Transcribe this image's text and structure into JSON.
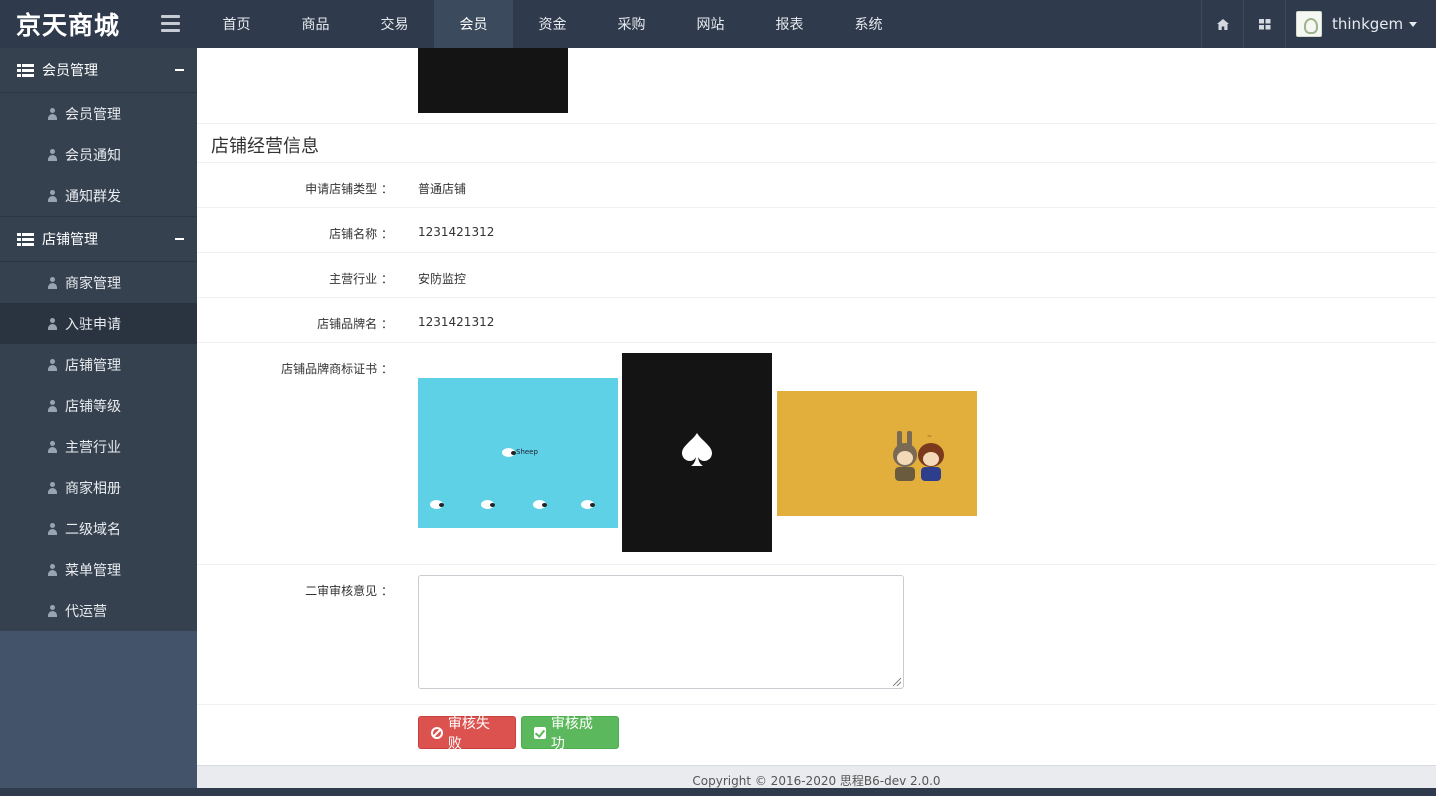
{
  "brand": {
    "title": "京天商城"
  },
  "nav": {
    "items": [
      {
        "label": "首页"
      },
      {
        "label": "商品"
      },
      {
        "label": "交易"
      },
      {
        "label": "会员"
      },
      {
        "label": "资金"
      },
      {
        "label": "采购"
      },
      {
        "label": "网站"
      },
      {
        "label": "报表"
      },
      {
        "label": "系统"
      }
    ],
    "active_index": 3
  },
  "user": {
    "name": "thinkgem"
  },
  "sidebar": {
    "groups": [
      {
        "label": "会员管理",
        "items": [
          {
            "label": "会员管理"
          },
          {
            "label": "会员通知"
          },
          {
            "label": "通知群发"
          }
        ]
      },
      {
        "label": "店铺管理",
        "items": [
          {
            "label": "商家管理"
          },
          {
            "label": "入驻申请"
          },
          {
            "label": "店铺管理"
          },
          {
            "label": "店铺等级"
          },
          {
            "label": "主营行业"
          },
          {
            "label": "商家相册"
          },
          {
            "label": "二级域名"
          },
          {
            "label": "菜单管理"
          },
          {
            "label": "代运营"
          }
        ]
      }
    ],
    "active_item": "入驻申请"
  },
  "section": {
    "title": "店铺经营信息"
  },
  "fields": [
    {
      "label": "申请店铺类型 ：",
      "value": "普通店铺"
    },
    {
      "label": "店铺名称 ：",
      "value": "1231421312"
    },
    {
      "label": "主营行业 ：",
      "value": "安防监控"
    },
    {
      "label": "店铺品牌名 ：",
      "value": "1231421312"
    }
  ],
  "certificate": {
    "label": "店铺品牌商标证书 ：",
    "images": [
      {
        "name": "sheep-image",
        "caption": "Sheep"
      },
      {
        "name": "spade-image"
      },
      {
        "name": "cartoon-image"
      }
    ]
  },
  "review": {
    "label": "二审审核意见 ：",
    "value": ""
  },
  "buttons": {
    "fail": "审核失败",
    "success": "审核成功"
  },
  "footer": {
    "text": "Copyright © 2016-2020  思程B6-dev  2.0.0"
  },
  "colors": {
    "topbar": "#2f3b4c",
    "sidebar": "#35414f",
    "danger": "#dc524f",
    "success": "#5cb85c"
  }
}
